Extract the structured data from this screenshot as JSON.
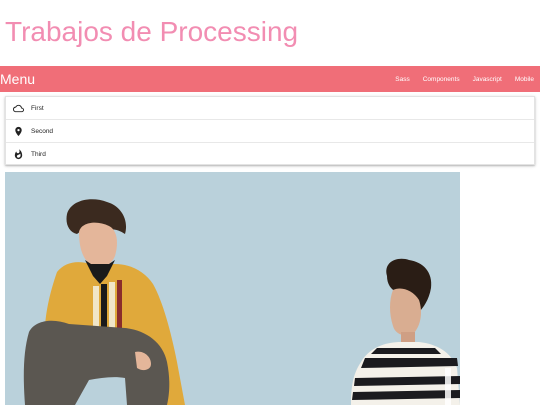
{
  "page": {
    "title": "Trabajos de Processing"
  },
  "navbar": {
    "brand": "Menu",
    "links": [
      {
        "label": "Sass"
      },
      {
        "label": "Components"
      },
      {
        "label": "Javascript"
      },
      {
        "label": "Mobile"
      }
    ]
  },
  "collapsible": {
    "items": [
      {
        "icon": "cloud-icon",
        "label": "First"
      },
      {
        "icon": "place-icon",
        "label": "Second"
      },
      {
        "icon": "whatshot-icon",
        "label": "Third"
      }
    ]
  },
  "photo": {
    "subject": "two men posing against a light blue background"
  },
  "colors": {
    "title": "#f28db2",
    "navbar": "#f06e78",
    "photo_background": "#b5cdd8"
  }
}
